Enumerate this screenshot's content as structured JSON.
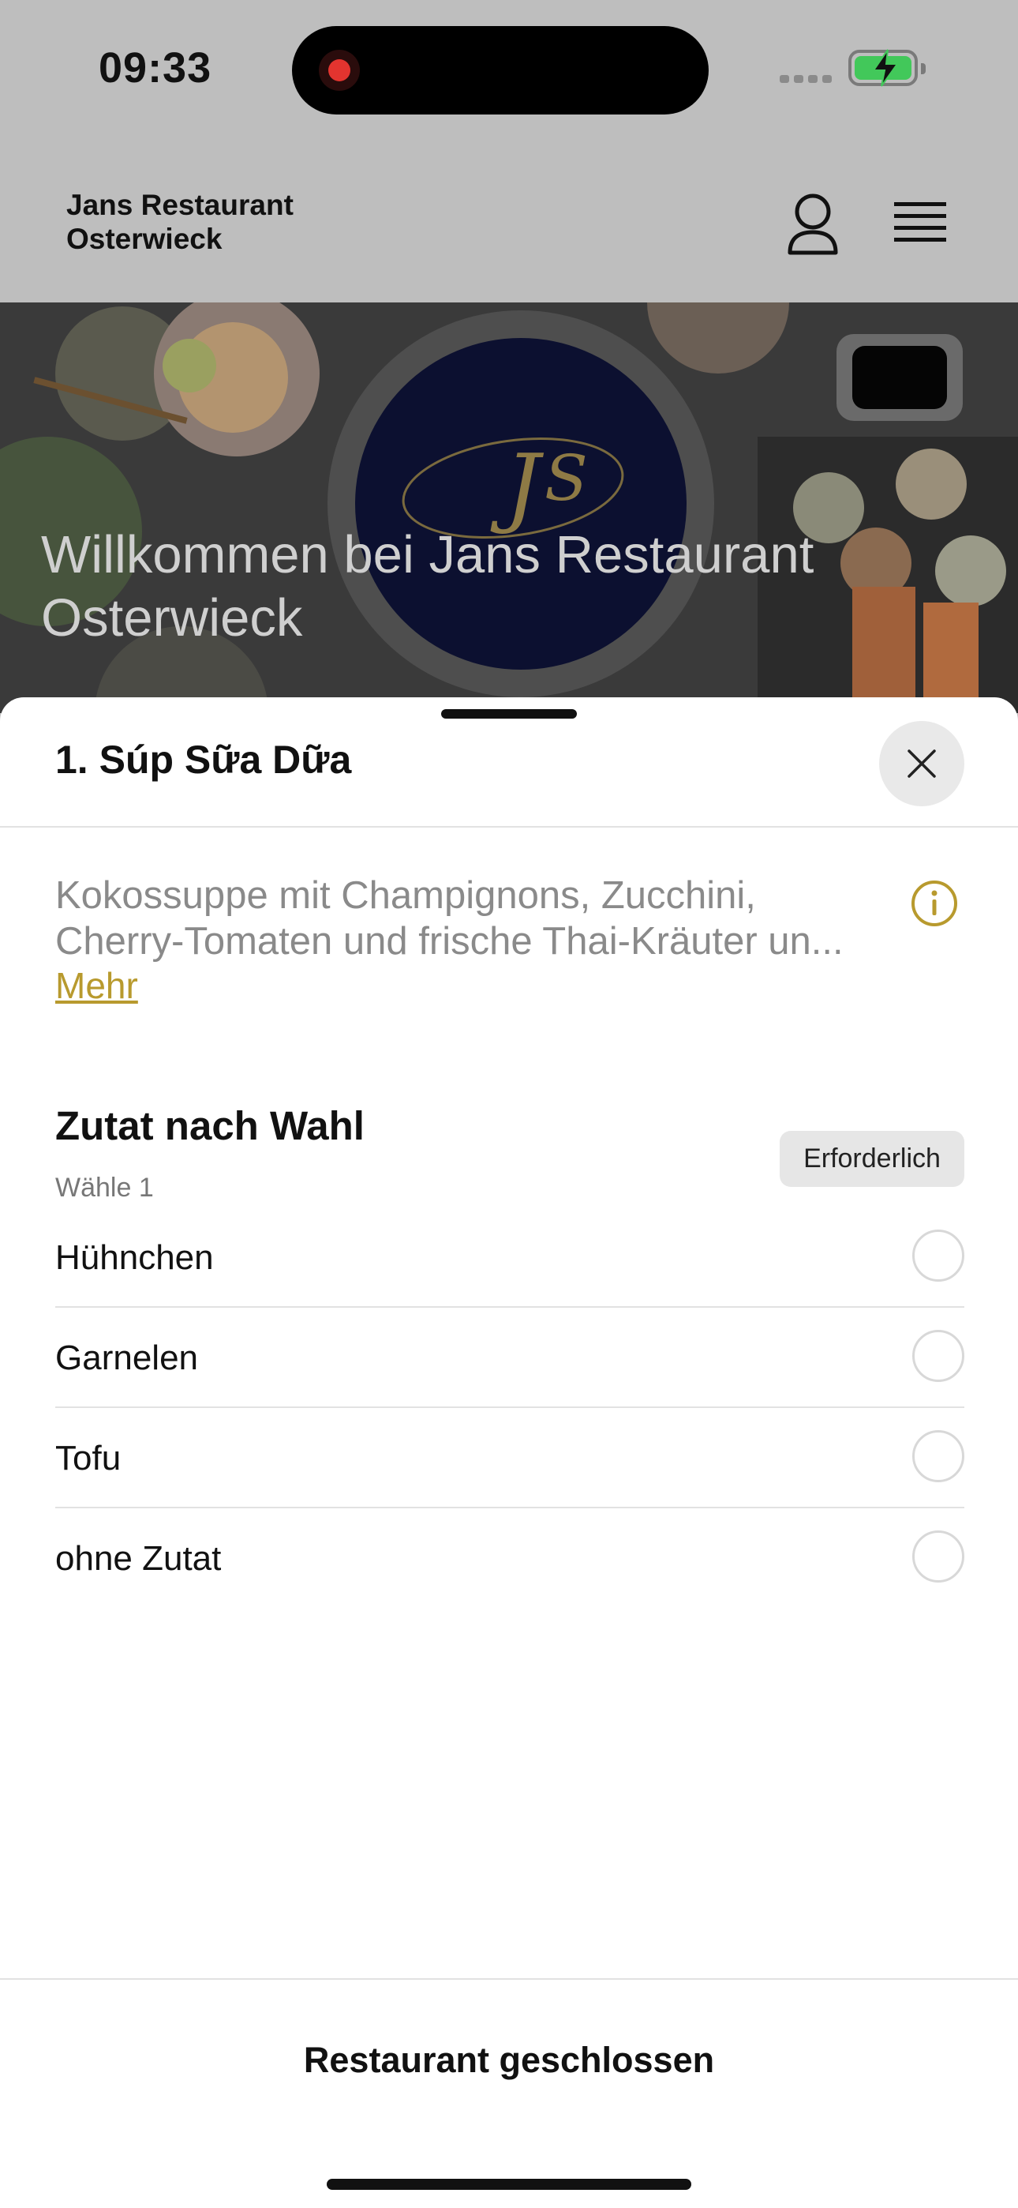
{
  "status_bar": {
    "time": "09:33",
    "recording_indicator": "recording-dot-icon",
    "battery_color": "#42c85a"
  },
  "header": {
    "brand_line1": "Jans Restaurant",
    "brand_line2": "Osterwieck",
    "account_icon": "user-icon",
    "menu_icon": "hamburger-menu-icon"
  },
  "hero": {
    "title": "Willkommen bei Jans Restaurant Osterwieck"
  },
  "sheet": {
    "title": "1. Súp Sữa Dữa",
    "close_icon": "close-icon",
    "description_line1": "Kokossuppe mit Champignons, Zucchini,",
    "description_line2": "Cherry-Tomaten und frische Thai-Kräuter un...",
    "more_label": "Mehr",
    "info_icon": "info-icon",
    "accent_color": "#b89a2e",
    "group": {
      "title": "Zutat nach Wahl",
      "subtitle": "Wähle 1",
      "badge": "Erforderlich",
      "options": [
        {
          "label": "Hühnchen",
          "selected": false
        },
        {
          "label": "Garnelen",
          "selected": false
        },
        {
          "label": "Tofu",
          "selected": false
        },
        {
          "label": "ohne Zutat",
          "selected": false
        }
      ]
    },
    "footer_status": "Restaurant geschlossen"
  }
}
